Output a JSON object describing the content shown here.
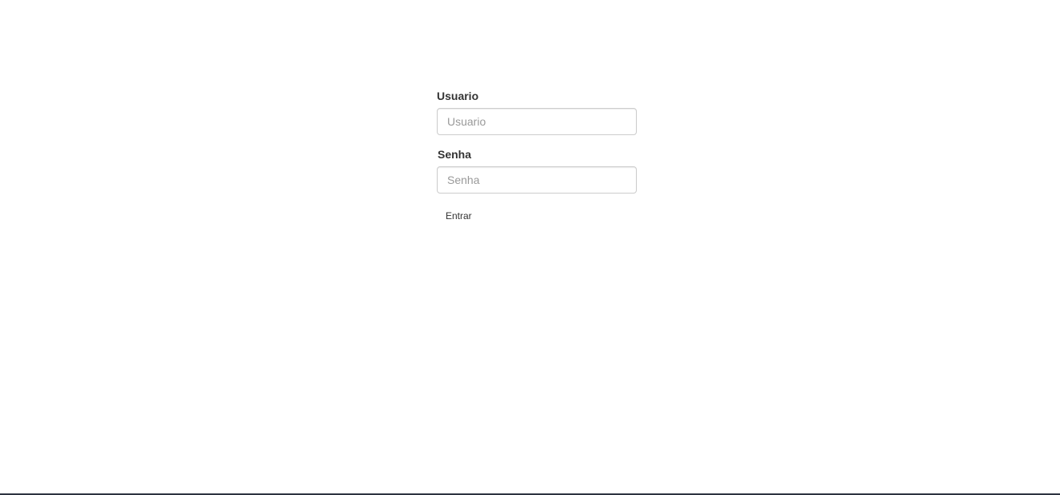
{
  "login": {
    "username_label": "Usuario",
    "username_placeholder": "Usuario",
    "username_value": "",
    "password_label": "Senha",
    "password_placeholder": "Senha",
    "password_value": "",
    "submit_label": "Entrar"
  },
  "colors": {
    "background": "#ffffff",
    "label_text": "#333333",
    "input_border": "#cccccc",
    "placeholder": "#999999",
    "bottom_bar": "#2d3340"
  }
}
